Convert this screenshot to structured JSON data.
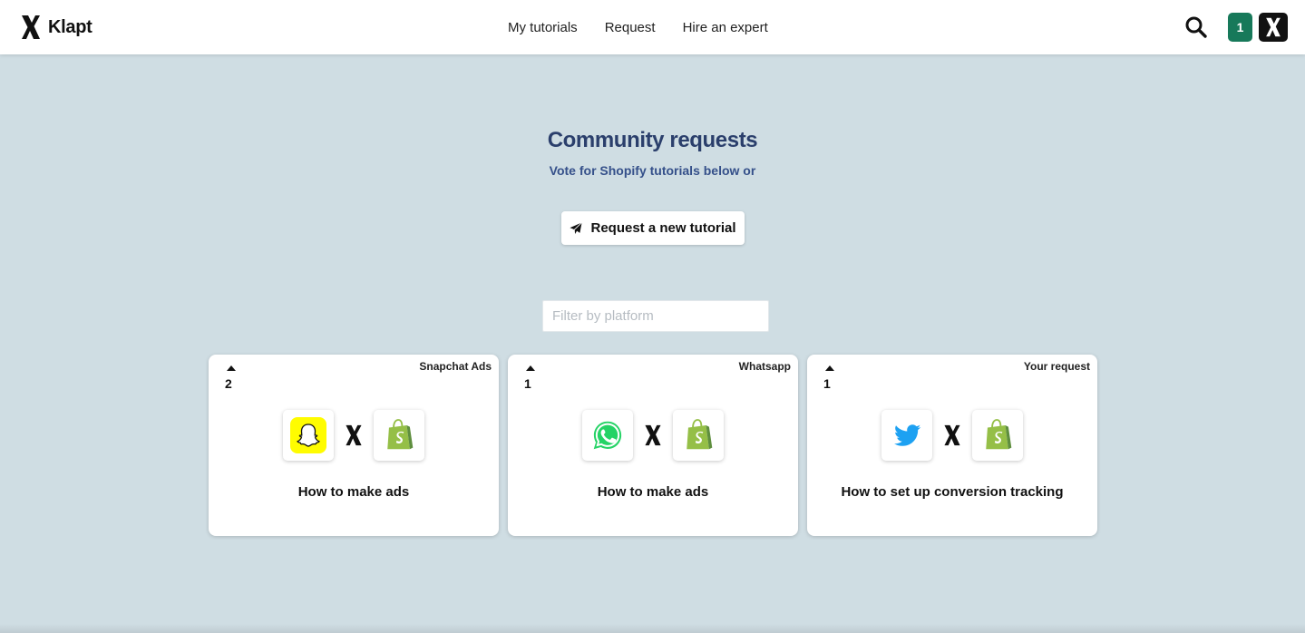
{
  "brand": {
    "name": "Klapt",
    "icon": "klapt-x-logo-icon"
  },
  "nav": [
    {
      "label": "My tutorials"
    },
    {
      "label": "Request"
    },
    {
      "label": "Hire an expert"
    }
  ],
  "header": {
    "search_icon": "search-icon",
    "notification_count": "1",
    "accent": "#17795a"
  },
  "page": {
    "title": "Community requests",
    "subtitle": "Vote for Shopify tutorials below or",
    "request_button": {
      "label": "Request a new tutorial",
      "icon": "paper-plane-icon"
    },
    "filter": {
      "placeholder": "Filter by platform",
      "value": ""
    }
  },
  "cards": [
    {
      "votes": "2",
      "tag": "Snapchat Ads",
      "platform_icon": "snapchat-icon",
      "partner_icon": "shopify-icon",
      "title": "How to make ads"
    },
    {
      "votes": "1",
      "tag": "Whatsapp",
      "platform_icon": "whatsapp-icon",
      "partner_icon": "shopify-icon",
      "title": "How to make ads"
    },
    {
      "votes": "1",
      "tag": "Your request",
      "platform_icon": "twitter-icon",
      "partner_icon": "shopify-icon",
      "title": "How to set up conversion tracking"
    }
  ],
  "colors": {
    "background": "#cfdde3",
    "heading": "#2b3f6c",
    "subheading": "#35508a",
    "snapchat": "#fffc00",
    "whatsapp": "#25d366",
    "twitter": "#1da1f2",
    "shopify": "#95bf47"
  }
}
